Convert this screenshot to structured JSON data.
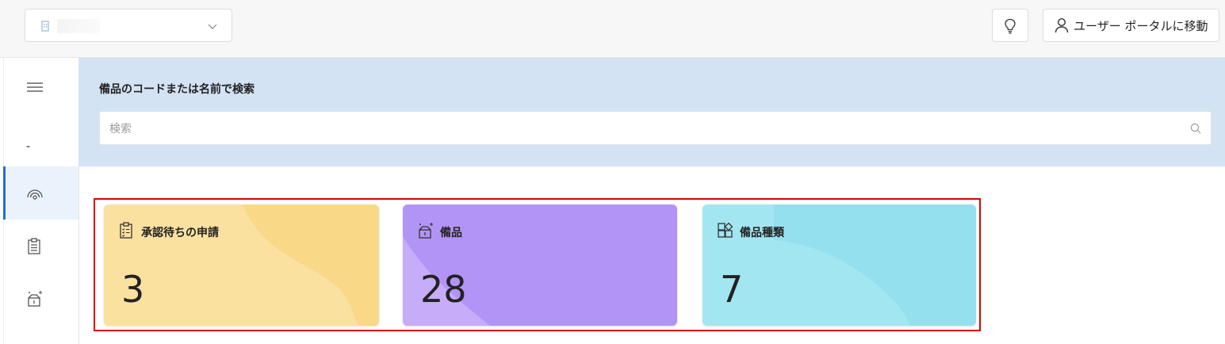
{
  "header": {
    "org_name": "",
    "portal_button_label": "ユーザー ポータルに移動"
  },
  "sidebar": {
    "items": [
      {
        "icon": "menu-icon"
      },
      {
        "label": "-"
      },
      {
        "icon": "dashboard-icon",
        "active": true
      },
      {
        "icon": "clipboard-icon"
      },
      {
        "icon": "equipment-icon"
      }
    ]
  },
  "search": {
    "title": "備品のコードまたは名前で検索",
    "placeholder": "検索"
  },
  "cards": [
    {
      "title": "承認待ちの申請",
      "value": "3",
      "icon": "clipboard-check-icon",
      "color": "#fbe1a0",
      "accent": "#f9d888"
    },
    {
      "title": "備品",
      "value": "28",
      "icon": "equipment-icon",
      "color": "#b294f6",
      "accent": "#c6acf9"
    },
    {
      "title": "備品種類",
      "value": "7",
      "icon": "categories-icon",
      "color": "#a2e6f1",
      "accent": "#94e0ef"
    }
  ],
  "colors": {
    "accent": "#1f6fd1",
    "search_panel": "#d3e3f4",
    "highlight_border": "#e00000"
  }
}
